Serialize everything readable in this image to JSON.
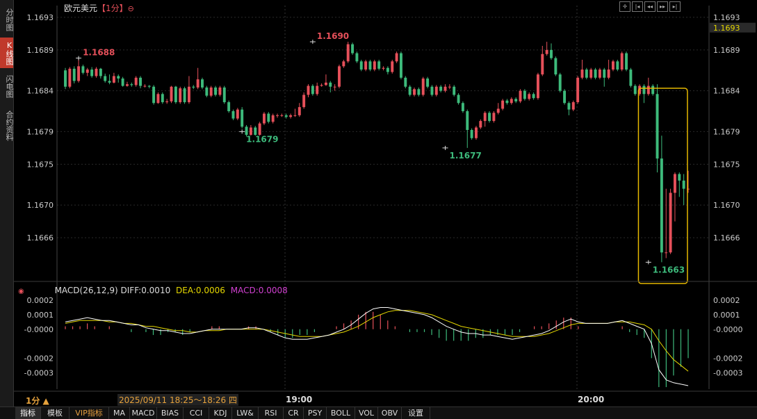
{
  "sidebar": {
    "items": [
      {
        "label": "分时图",
        "active": false
      },
      {
        "label": "K线图",
        "active": true
      },
      {
        "label": "闪电图",
        "active": false
      },
      {
        "label": "合约资料",
        "active": false
      }
    ]
  },
  "header": {
    "title": "欧元美元",
    "period_tag": "【1分】",
    "current_price_label": "1.1693"
  },
  "toolbar_icons": [
    "crosshair-icon",
    "first-page-icon",
    "prev-page-icon",
    "next-page-icon",
    "last-page-icon"
  ],
  "macd": {
    "title": "MACD(26,12,9)",
    "diff": "DIFF:0.0010",
    "dea": "DEA:0.0006",
    "macd": "MACD:0.0008"
  },
  "footer": {
    "period_indicator": "1分 ▲",
    "date_range": "2025/09/11 18:25～18:26 四",
    "time_ticks": [
      "19:00",
      "20:00"
    ]
  },
  "tabs": [
    "指标",
    "模板",
    "VIP指标",
    "MA",
    "MACD",
    "BIAS",
    "CCI",
    "KDJ",
    "LW&",
    "RSI",
    "CR",
    "PSY",
    "BOLL",
    "VOL",
    "OBV",
    "设置"
  ],
  "colors": {
    "up": "#e6505a",
    "down": "#3dba7b",
    "diff_line": "#ffffff",
    "dea_line": "#e6d800",
    "macd_label": "#d040d0",
    "highlight_box": "#e6b800"
  },
  "chart_data": [
    {
      "type": "candlestick",
      "title": "欧元美元",
      "ylim": [
        1.16615,
        1.16935
      ],
      "yticks": [
        "1.1693",
        "1.1689",
        "1.1684",
        "1.1679",
        "1.1675",
        "1.1670",
        "1.1666"
      ],
      "ytick_values": [
        1.1693,
        1.1689,
        1.1684,
        1.1679,
        1.1675,
        1.167,
        1.1666
      ],
      "annotations": [
        {
          "label": "1.1688",
          "type": "high",
          "index": 3,
          "value": 1.1688
        },
        {
          "label": "1.1690",
          "type": "high",
          "index": 56,
          "value": 1.169
        },
        {
          "label": "1.1679",
          "type": "low",
          "index": 40,
          "value": 1.1679
        },
        {
          "label": "1.1677",
          "type": "low",
          "index": 86,
          "value": 1.1677
        },
        {
          "label": "1.1663",
          "type": "low",
          "index": 132,
          "value": 1.1663
        }
      ],
      "highlight_range": [
        131,
        138
      ],
      "candles": [
        [
          1.16865,
          1.16845,
          1.16868,
          1.16842
        ],
        [
          1.16845,
          1.16867,
          1.16869,
          1.16843
        ],
        [
          1.16867,
          1.16852,
          1.1687,
          1.16849
        ],
        [
          1.16852,
          1.1687,
          1.1688,
          1.1685
        ],
        [
          1.1687,
          1.16862,
          1.16872,
          1.1686
        ],
        [
          1.16862,
          1.16866,
          1.16868,
          1.16858
        ],
        [
          1.16866,
          1.16858,
          1.16869,
          1.16856
        ],
        [
          1.16858,
          1.16867,
          1.16869,
          1.16856
        ],
        [
          1.16867,
          1.16858,
          1.16868,
          1.16855
        ],
        [
          1.16858,
          1.16852,
          1.16861,
          1.1685
        ],
        [
          1.16852,
          1.1685,
          1.1686,
          1.16848
        ],
        [
          1.1685,
          1.16858,
          1.16862,
          1.16849
        ],
        [
          1.16858,
          1.16855,
          1.1686,
          1.1685
        ],
        [
          1.16855,
          1.16846,
          1.16857,
          1.16845
        ],
        [
          1.16846,
          1.16848,
          1.16851,
          1.16845
        ],
        [
          1.16848,
          1.16847,
          1.1685,
          1.16845
        ],
        [
          1.16847,
          1.16856,
          1.16858,
          1.16845
        ],
        [
          1.16856,
          1.16846,
          1.16858,
          1.16843
        ],
        [
          1.16846,
          1.16846,
          1.16848,
          1.16844
        ],
        [
          1.16846,
          1.16845,
          1.16847,
          1.16843
        ],
        [
          1.16845,
          1.16825,
          1.16847,
          1.16823
        ],
        [
          1.16825,
          1.16836,
          1.16838,
          1.16824
        ],
        [
          1.16836,
          1.16826,
          1.16838,
          1.16824
        ],
        [
          1.16826,
          1.16827,
          1.1683,
          1.16824
        ],
        [
          1.16827,
          1.16845,
          1.16846,
          1.16825
        ],
        [
          1.16845,
          1.16826,
          1.16846,
          1.16824
        ],
        [
          1.16826,
          1.16843,
          1.16845,
          1.16824
        ],
        [
          1.16843,
          1.16826,
          1.16845,
          1.16824
        ],
        [
          1.16826,
          1.16845,
          1.16858,
          1.16824
        ],
        [
          1.16845,
          1.16844,
          1.16847,
          1.16842
        ],
        [
          1.16844,
          1.16854,
          1.16868,
          1.16842
        ],
        [
          1.16854,
          1.16844,
          1.16856,
          1.16842
        ],
        [
          1.16844,
          1.16834,
          1.16846,
          1.16832
        ],
        [
          1.16834,
          1.16844,
          1.16846,
          1.16832
        ],
        [
          1.16844,
          1.16835,
          1.16846,
          1.16833
        ],
        [
          1.16835,
          1.16844,
          1.16846,
          1.16833
        ],
        [
          1.16844,
          1.16826,
          1.16846,
          1.16824
        ],
        [
          1.16826,
          1.16815,
          1.16828,
          1.16813
        ],
        [
          1.16815,
          1.16806,
          1.16817,
          1.16804
        ],
        [
          1.16806,
          1.16817,
          1.16819,
          1.16804
        ],
        [
          1.16817,
          1.16796,
          1.1682,
          1.16794
        ],
        [
          1.16796,
          1.16786,
          1.16798,
          1.16784
        ],
        [
          1.16786,
          1.16795,
          1.16798,
          1.16785
        ],
        [
          1.16795,
          1.16786,
          1.16797,
          1.16785
        ],
        [
          1.16786,
          1.168,
          1.16802,
          1.16785
        ],
        [
          1.168,
          1.16812,
          1.16814,
          1.16798
        ],
        [
          1.16812,
          1.16802,
          1.16814,
          1.168
        ],
        [
          1.16802,
          1.1681,
          1.16812,
          1.168
        ],
        [
          1.1681,
          1.1681,
          1.16812,
          1.16807
        ],
        [
          1.1681,
          1.1681,
          1.16812,
          1.16808
        ],
        [
          1.1681,
          1.16808,
          1.16812,
          1.16806
        ],
        [
          1.16808,
          1.1681,
          1.16812,
          1.16806
        ],
        [
          1.1681,
          1.1681,
          1.16818,
          1.16808
        ],
        [
          1.1681,
          1.1682,
          1.16825,
          1.16808
        ],
        [
          1.1682,
          1.16835,
          1.16838,
          1.16818
        ],
        [
          1.16835,
          1.16846,
          1.16848,
          1.16832
        ],
        [
          1.16846,
          1.16836,
          1.16848,
          1.16834
        ],
        [
          1.16836,
          1.16846,
          1.1685,
          1.16834
        ],
        [
          1.16846,
          1.16847,
          1.16849,
          1.16845
        ],
        [
          1.16847,
          1.1685,
          1.1686,
          1.16846
        ],
        [
          1.1685,
          1.16845,
          1.16852,
          1.16838
        ],
        [
          1.16845,
          1.16845,
          1.16848,
          1.1684
        ],
        [
          1.16845,
          1.1687,
          1.16872,
          1.16843
        ],
        [
          1.1687,
          1.16876,
          1.16878,
          1.16868
        ],
        [
          1.16876,
          1.16897,
          1.169,
          1.16874
        ],
        [
          1.16897,
          1.16886,
          1.16899,
          1.16884
        ],
        [
          1.16886,
          1.16876,
          1.16888,
          1.16874
        ],
        [
          1.16876,
          1.16866,
          1.16878,
          1.16864
        ],
        [
          1.16866,
          1.16876,
          1.16878,
          1.16864
        ],
        [
          1.16876,
          1.16866,
          1.16878,
          1.16864
        ],
        [
          1.16866,
          1.16876,
          1.16878,
          1.16864
        ],
        [
          1.16876,
          1.16867,
          1.16878,
          1.16865
        ],
        [
          1.16867,
          1.16868,
          1.1687,
          1.16865
        ],
        [
          1.16868,
          1.16863,
          1.1687,
          1.1686
        ],
        [
          1.16863,
          1.16876,
          1.16878,
          1.16861
        ],
        [
          1.16876,
          1.16886,
          1.16888,
          1.16874
        ],
        [
          1.16886,
          1.16856,
          1.16888,
          1.16854
        ],
        [
          1.16856,
          1.16845,
          1.16858,
          1.16843
        ],
        [
          1.16845,
          1.16835,
          1.16847,
          1.16833
        ],
        [
          1.16835,
          1.16842,
          1.16844,
          1.16833
        ],
        [
          1.16842,
          1.16835,
          1.16844,
          1.16833
        ],
        [
          1.16835,
          1.16855,
          1.16857,
          1.16833
        ],
        [
          1.16855,
          1.16845,
          1.16857,
          1.16843
        ],
        [
          1.16845,
          1.16835,
          1.16847,
          1.16833
        ],
        [
          1.16835,
          1.16845,
          1.16847,
          1.16833
        ],
        [
          1.16845,
          1.1684,
          1.16847,
          1.16838
        ],
        [
          1.1684,
          1.16845,
          1.16848,
          1.16838
        ],
        [
          1.16845,
          1.16845,
          1.16848,
          1.16842
        ],
        [
          1.16845,
          1.16835,
          1.16847,
          1.16833
        ],
        [
          1.16835,
          1.16825,
          1.16837,
          1.16823
        ],
        [
          1.16825,
          1.16815,
          1.16827,
          1.16813
        ],
        [
          1.16815,
          1.16792,
          1.16817,
          1.1677
        ],
        [
          1.16792,
          1.16782,
          1.16794,
          1.1678
        ],
        [
          1.16782,
          1.16795,
          1.16797,
          1.1678
        ],
        [
          1.16795,
          1.16803,
          1.16805,
          1.16793
        ],
        [
          1.16803,
          1.16813,
          1.16815,
          1.16796
        ],
        [
          1.16813,
          1.16803,
          1.16815,
          1.16801
        ],
        [
          1.16803,
          1.16813,
          1.16815,
          1.16801
        ],
        [
          1.16813,
          1.16818,
          1.16825,
          1.16811
        ],
        [
          1.16818,
          1.16828,
          1.1683,
          1.16816
        ],
        [
          1.16828,
          1.16825,
          1.1683,
          1.16823
        ],
        [
          1.16825,
          1.1683,
          1.16832,
          1.16823
        ],
        [
          1.1683,
          1.16827,
          1.16832,
          1.16825
        ],
        [
          1.16827,
          1.1684,
          1.16842,
          1.16825
        ],
        [
          1.1684,
          1.1683,
          1.16842,
          1.16828
        ],
        [
          1.1683,
          1.16836,
          1.16838,
          1.16828
        ],
        [
          1.16836,
          1.16831,
          1.16838,
          1.16829
        ],
        [
          1.16831,
          1.1686,
          1.16862,
          1.16829
        ],
        [
          1.1686,
          1.16885,
          1.16895,
          1.16858
        ],
        [
          1.16885,
          1.1689,
          1.169,
          1.16883
        ],
        [
          1.1689,
          1.1688,
          1.16898,
          1.16878
        ],
        [
          1.1688,
          1.1686,
          1.16882,
          1.16858
        ],
        [
          1.1686,
          1.1684,
          1.16862,
          1.16838
        ],
        [
          1.1684,
          1.16825,
          1.16842,
          1.16823
        ],
        [
          1.16825,
          1.16817,
          1.16827,
          1.1681
        ],
        [
          1.16817,
          1.16826,
          1.16828,
          1.16815
        ],
        [
          1.16826,
          1.16856,
          1.16858,
          1.16824
        ],
        [
          1.16856,
          1.16866,
          1.16878,
          1.16854
        ],
        [
          1.16866,
          1.16856,
          1.16868,
          1.16854
        ],
        [
          1.16856,
          1.16866,
          1.16868,
          1.16854
        ],
        [
          1.16866,
          1.16856,
          1.16868,
          1.16854
        ],
        [
          1.16856,
          1.16866,
          1.16868,
          1.16854
        ],
        [
          1.16866,
          1.16856,
          1.16868,
          1.16845
        ],
        [
          1.16856,
          1.16866,
          1.16878,
          1.16854
        ],
        [
          1.16866,
          1.16876,
          1.16878,
          1.16864
        ],
        [
          1.16876,
          1.16866,
          1.16878,
          1.16864
        ],
        [
          1.16866,
          1.16886,
          1.16888,
          1.16864
        ],
        [
          1.16886,
          1.16866,
          1.16888,
          1.16864
        ],
        [
          1.16866,
          1.16846,
          1.16868,
          1.16844
        ],
        [
          1.16846,
          1.16836,
          1.16848,
          1.16834
        ],
        [
          1.16836,
          1.16846,
          1.16848,
          1.16834
        ],
        [
          1.16846,
          1.16836,
          1.16848,
          1.16825
        ],
        [
          1.16836,
          1.16846,
          1.16856,
          1.16834
        ],
        [
          1.16846,
          1.16836,
          1.16848,
          1.16834
        ],
        [
          1.16836,
          1.16757,
          1.16848,
          1.1674
        ],
        [
          1.16757,
          1.16642,
          1.16785,
          1.1663
        ],
        [
          1.16642,
          1.16642,
          1.1672,
          1.16635
        ],
        [
          1.16642,
          1.16715,
          1.1672,
          1.1664
        ],
        [
          1.16715,
          1.16738,
          1.1674,
          1.1668
        ],
        [
          1.16738,
          1.1673,
          1.1674,
          1.1671
        ],
        [
          1.1673,
          1.1672,
          1.16738,
          1.167
        ],
        [
          1.1672,
          1.1672,
          1.16742,
          1.16715
        ]
      ]
    },
    {
      "type": "macd",
      "title": "MACD(26,12,9)",
      "ylim": [
        -0.00039,
        0.00021
      ],
      "yticks": [
        "0.0002",
        "0.0001",
        "-0.0000",
        "-0.0002",
        "-0.0003"
      ],
      "ytick_values": [
        0.0002,
        0.0001,
        0.0,
        -0.0002,
        -0.0003
      ],
      "diff": [
        5e-05,
        6e-05,
        7e-05,
        8e-05,
        7e-05,
        6e-05,
        6e-05,
        5e-05,
        4e-05,
        3e-05,
        3e-05,
        1e-05,
        0.0,
        -1e-05,
        -1e-05,
        -2e-05,
        -3e-05,
        -3e-05,
        -2e-05,
        -1e-05,
        0.0,
        0.0,
        0.0,
        0.0,
        0.0,
        1e-05,
        1e-05,
        0.0,
        -2e-05,
        -4e-05,
        -6e-05,
        -7e-05,
        -7e-05,
        -7e-05,
        -6e-05,
        -5e-05,
        -4e-05,
        -2e-05,
        0.0,
        3e-05,
        7e-05,
        0.00011,
        0.00014,
        0.00015,
        0.00015,
        0.00014,
        0.00013,
        0.00012,
        0.00011,
        0.0001,
        8e-05,
        5e-05,
        2e-05,
        0.0,
        -2e-05,
        -3e-05,
        -3e-05,
        -4e-05,
        -4e-05,
        -5e-05,
        -6e-05,
        -7e-05,
        -6e-05,
        -5e-05,
        -4e-05,
        -3e-05,
        -1e-05,
        2e-05,
        5e-05,
        7e-05,
        5e-05,
        4e-05,
        4e-05,
        4e-05,
        4e-05,
        5e-05,
        6e-05,
        4e-05,
        2e-05,
        0.0,
        -0.0001,
        -0.00028,
        -0.00035,
        -0.00037,
        -0.00038,
        -0.00039
      ],
      "dea": [
        4e-05,
        5e-05,
        6e-05,
        6e-05,
        6e-05,
        6e-05,
        5e-05,
        5e-05,
        4e-05,
        4e-05,
        3e-05,
        2e-05,
        2e-05,
        1e-05,
        0.0,
        -1e-05,
        -1e-05,
        -2e-05,
        -2e-05,
        -1e-05,
        -1e-05,
        -1e-05,
        0.0,
        0.0,
        0.0,
        0.0,
        0.0,
        0.0,
        -1e-05,
        -2e-05,
        -3e-05,
        -4e-05,
        -5e-05,
        -5e-05,
        -5e-05,
        -5e-05,
        -4e-05,
        -3e-05,
        -2e-05,
        0.0,
        2e-05,
        5e-05,
        8e-05,
        0.0001,
        0.00012,
        0.00013,
        0.00013,
        0.00013,
        0.00012,
        0.00011,
        0.0001,
        8e-05,
        6e-05,
        4e-05,
        2e-05,
        1e-05,
        0.0,
        -1e-05,
        -2e-05,
        -3e-05,
        -4e-05,
        -5e-05,
        -5e-05,
        -5e-05,
        -5e-05,
        -4e-05,
        -3e-05,
        -1e-05,
        1e-05,
        3e-05,
        4e-05,
        4e-05,
        4e-05,
        4e-05,
        4e-05,
        5e-05,
        5e-05,
        5e-05,
        4e-05,
        3e-05,
        0.0,
        -8e-05,
        -0.00015,
        -0.00021,
        -0.00025,
        -0.00029
      ]
    }
  ]
}
